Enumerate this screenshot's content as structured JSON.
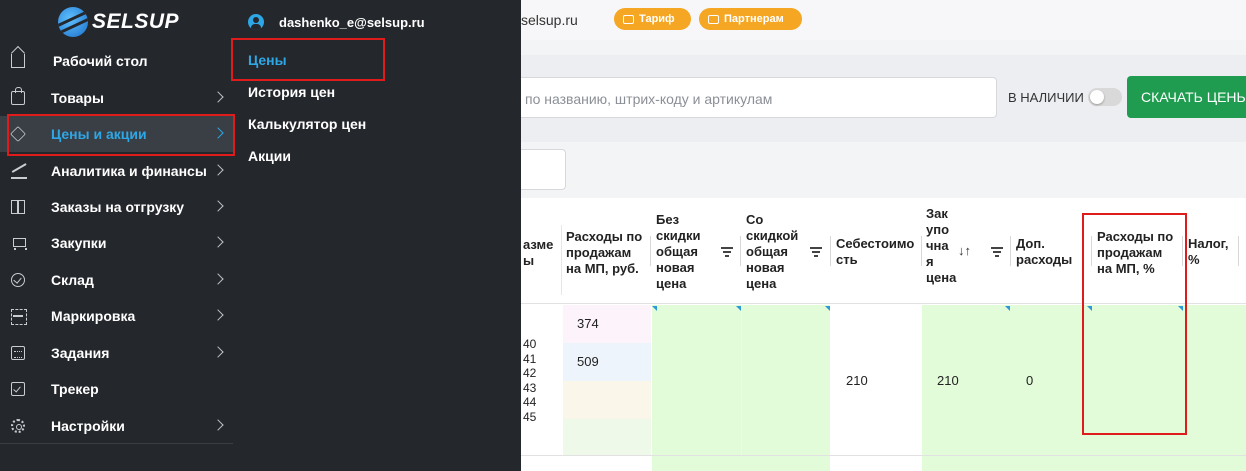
{
  "header": {
    "email_tail": "selsup.ru",
    "tariff_label": "Тариф",
    "partners_label": "Партнерам"
  },
  "toolbar": {
    "search_placeholder": "по названию, штрих-коду и артикулам",
    "in_stock_label": "В НАЛИЧИИ",
    "in_stock_enabled": false,
    "download_button": "СКАЧАТЬ ЦЕНЫ"
  },
  "table": {
    "columns": [
      {
        "key": "size",
        "label": "азме\nы"
      },
      {
        "key": "mp_expenses_rub",
        "label": "Расходы по\nпродажам\nна МП, руб."
      },
      {
        "key": "new_price_no_discount",
        "label": "Без\nскидки\nобщая\nновая\nцена"
      },
      {
        "key": "new_price_discount",
        "label": "Со\nскидкой\nобщая\nновая\nцена"
      },
      {
        "key": "cost",
        "label": "Себестоимо\nсть"
      },
      {
        "key": "purchase_price",
        "label": "Зак\nупо\nчна\nя\nцена"
      },
      {
        "key": "extra_expenses",
        "label": "Доп.\nрасходы"
      },
      {
        "key": "mp_expenses_pct",
        "label": "Расходы по\nпродажам\nна МП, %"
      },
      {
        "key": "tax",
        "label": "Налог,\n%"
      }
    ],
    "row": {
      "sizes": "40\n41\n42\n43\n44\n45",
      "mp_expenses_rub": [
        "374",
        "509",
        "",
        ""
      ],
      "cost": "210",
      "purchase_price": "210",
      "extra_expenses": "0"
    }
  },
  "sidebar": {
    "logo_text": "SELSUP",
    "items": [
      {
        "label": "Рабочий стол",
        "icon": "home-icon",
        "has_chevron": false,
        "active": false
      },
      {
        "label": "Товары",
        "icon": "shopping-bag-icon",
        "has_chevron": true,
        "active": false
      },
      {
        "label": "Цены и акции",
        "icon": "price-tag-icon",
        "has_chevron": true,
        "active": true
      },
      {
        "label": "Аналитика и финансы",
        "icon": "line-chart-icon",
        "has_chevron": true,
        "active": false
      },
      {
        "label": "Заказы на отгрузку",
        "icon": "package-icon",
        "has_chevron": true,
        "active": false
      },
      {
        "label": "Закупки",
        "icon": "cart-icon",
        "has_chevron": true,
        "active": false
      },
      {
        "label": "Склад",
        "icon": "check-circle-icon",
        "has_chevron": true,
        "active": false
      },
      {
        "label": "Маркировка",
        "icon": "scan-icon",
        "has_chevron": true,
        "active": false
      },
      {
        "label": "Задания",
        "icon": "calendar-icon",
        "has_chevron": true,
        "active": false
      },
      {
        "label": "Трекер",
        "icon": "tracker-icon",
        "has_chevron": false,
        "active": false
      },
      {
        "label": "Настройки",
        "icon": "gear-icon",
        "has_chevron": true,
        "active": false
      }
    ]
  },
  "submenu": {
    "user_email": "dashenko_e@selsup.ru",
    "items": [
      {
        "label": "Цены",
        "active": true
      },
      {
        "label": "История цен",
        "active": false
      },
      {
        "label": "Калькулятор цен",
        "active": false
      },
      {
        "label": "Акции",
        "active": false
      }
    ]
  },
  "colors": {
    "sidebar_bg": "#24272c",
    "accent_blue": "#2ea7e6",
    "highlight_red": "#e01b1b",
    "download_green": "#1f9c4f",
    "badge_orange": "#f5a623",
    "cell_green": "#e2fbd9",
    "cell_pink": "#fdf3fb",
    "cell_blue": "#eef4fb",
    "cell_beige": "#fbf6ea"
  }
}
